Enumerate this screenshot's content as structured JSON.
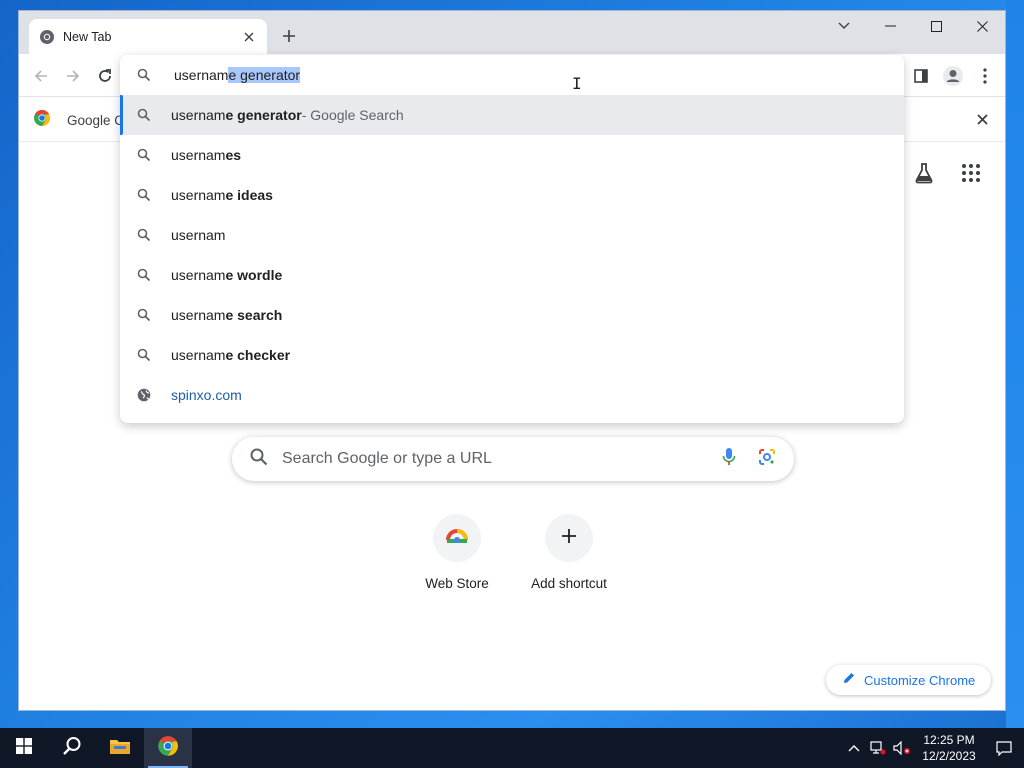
{
  "browser": {
    "tab": {
      "title": "New Tab"
    },
    "bookmarks_bar": {
      "item_label": "Google C"
    }
  },
  "omnibox": {
    "typed_prefix": "usernam",
    "autocomplete_selected": "e generator",
    "suggestions": [
      {
        "prefix": "usernam",
        "bold": "e generator",
        "suffix": " - Google Search",
        "icon": "search-icon"
      },
      {
        "prefix": "usernam",
        "bold": "es",
        "suffix": "",
        "icon": "search-icon"
      },
      {
        "prefix": "usernam",
        "bold": "e ideas",
        "suffix": "",
        "icon": "search-icon"
      },
      {
        "prefix": "usernam",
        "bold": "",
        "suffix": "",
        "icon": "search-icon"
      },
      {
        "prefix": "usernam",
        "bold": "e wordle",
        "suffix": "",
        "icon": "search-icon"
      },
      {
        "prefix": "usernam",
        "bold": "e search",
        "suffix": "",
        "icon": "search-icon"
      },
      {
        "prefix": "usernam",
        "bold": "e checker",
        "suffix": "",
        "icon": "search-icon"
      }
    ],
    "url_suggestion": {
      "text": "spinxo.com",
      "icon": "globe-icon"
    }
  },
  "new_tab_page": {
    "search_placeholder": "Search Google or type a URL",
    "shortcuts": [
      {
        "label": "Web Store"
      },
      {
        "label": "Add shortcut"
      }
    ],
    "customize_label": "Customize Chrome"
  },
  "taskbar": {
    "time": "12:25 PM",
    "date": "12/2/2023"
  },
  "colors": {
    "accent": "#1a73e8",
    "taskbar": "#101828",
    "tab_strip": "#dee1e6"
  }
}
